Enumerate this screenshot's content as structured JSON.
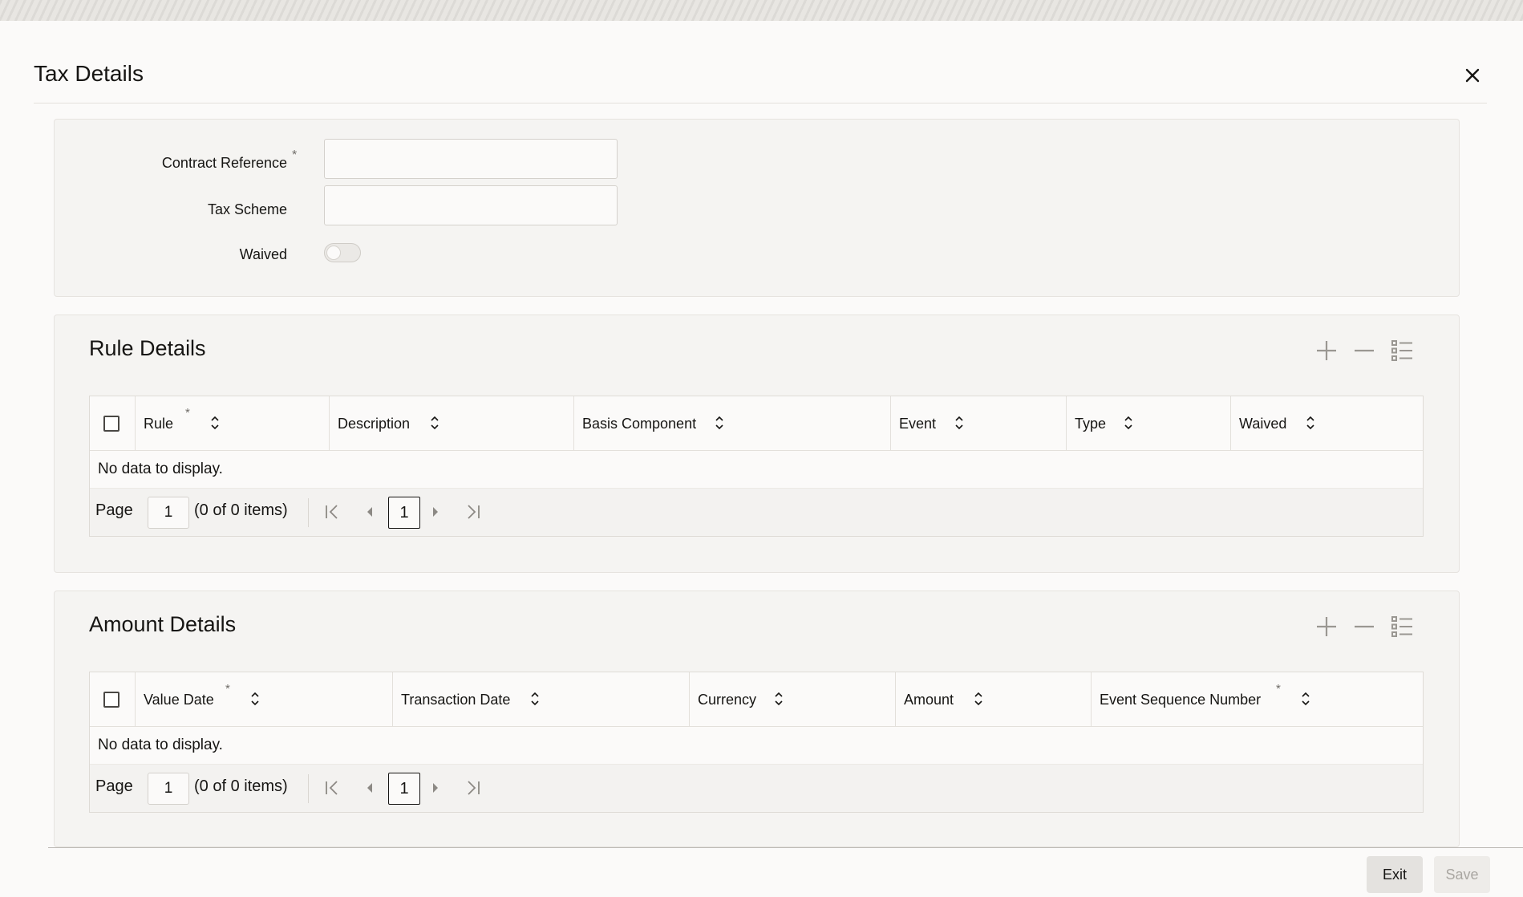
{
  "dialog": {
    "title": "Tax Details"
  },
  "header_form": {
    "contract_reference": {
      "label": "Contract Reference",
      "required_mark": "*",
      "value": ""
    },
    "tax_scheme": {
      "label": "Tax Scheme",
      "value": ""
    },
    "waived": {
      "label": "Waived",
      "checked": false
    }
  },
  "rule_details": {
    "title": "Rule Details",
    "columns": [
      {
        "label": "Rule",
        "required": "*"
      },
      {
        "label": "Description",
        "required": ""
      },
      {
        "label": "Basis Component",
        "required": ""
      },
      {
        "label": "Event",
        "required": ""
      },
      {
        "label": "Type",
        "required": ""
      },
      {
        "label": "Waived",
        "required": ""
      }
    ],
    "empty_text": "No data to display.",
    "pager": {
      "label": "Page",
      "page": "1",
      "items": "(0 of 0 items)",
      "current": "1"
    }
  },
  "amount_details": {
    "title": "Amount Details",
    "columns": [
      {
        "label": "Value Date",
        "required": "*"
      },
      {
        "label": "Transaction Date",
        "required": ""
      },
      {
        "label": "Currency",
        "required": ""
      },
      {
        "label": "Amount",
        "required": ""
      },
      {
        "label": "Event Sequence Number",
        "required": "*"
      }
    ],
    "empty_text": "No data to display.",
    "pager": {
      "label": "Page",
      "page": "1",
      "items": "(0 of 0 items)",
      "current": "1"
    }
  },
  "footer": {
    "exit_label": "Exit",
    "save_label": "Save"
  },
  "icons": {
    "close": "close-icon",
    "add": "plus-icon",
    "remove": "minus-icon",
    "columns": "list-icon",
    "sort": "sort-icon",
    "first": "first-page-icon",
    "prev": "prev-page-icon",
    "next": "next-page-icon",
    "last": "last-page-icon"
  }
}
